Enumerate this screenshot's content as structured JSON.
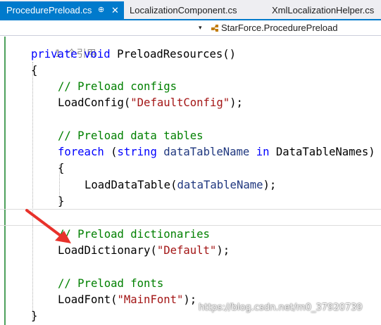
{
  "tabs": [
    {
      "label": "ProcedurePreload.cs",
      "active": true
    },
    {
      "label": "LocalizationComponent.cs",
      "active": false
    },
    {
      "label": "XmlLocalizationHelper.cs",
      "active": false
    }
  ],
  "navbar": {
    "member": "StarForce.ProcedurePreload",
    "member_icon": "class-icon"
  },
  "code": {
    "lens_hint": "1 个引用",
    "signature": {
      "kw_access": "private",
      "kw_type": "void",
      "name": "PreloadResources",
      "parens": "()"
    },
    "open_brace": "{",
    "comment_configs": "// Preload configs",
    "load_config": {
      "method": "LoadConfig",
      "open": "(",
      "arg": "\"DefaultConfig\"",
      "close": ");"
    },
    "comment_tables": "// Preload data tables",
    "foreach": {
      "kw": "foreach",
      "open": "(",
      "kw_type": "string",
      "var": "dataTableName",
      "kw_in": "in",
      "coll": "DataTableNames",
      "close": ")"
    },
    "inner_open": "{",
    "load_table": {
      "method": "LoadDataTable",
      "open": "(",
      "arg": "dataTableName",
      "close": ");"
    },
    "inner_close": "}",
    "comment_dicts": "// Preload dictionaries",
    "load_dict": {
      "method": "LoadDictionary",
      "open": "(",
      "arg": "\"Default\"",
      "close": ");"
    },
    "comment_fonts": "// Preload fonts",
    "load_font": {
      "method": "LoadFont",
      "open": "(",
      "arg": "\"MainFont\"",
      "close": ");"
    },
    "close_brace": "}"
  },
  "colors": {
    "keyword": "#0000ff",
    "comment": "#008000",
    "string": "#a31515",
    "parameter": "#1f377f",
    "accent": "#007acc",
    "annotation_arrow": "#e8322b"
  },
  "watermark": "https://blog.csdn.net/m0_37920739"
}
